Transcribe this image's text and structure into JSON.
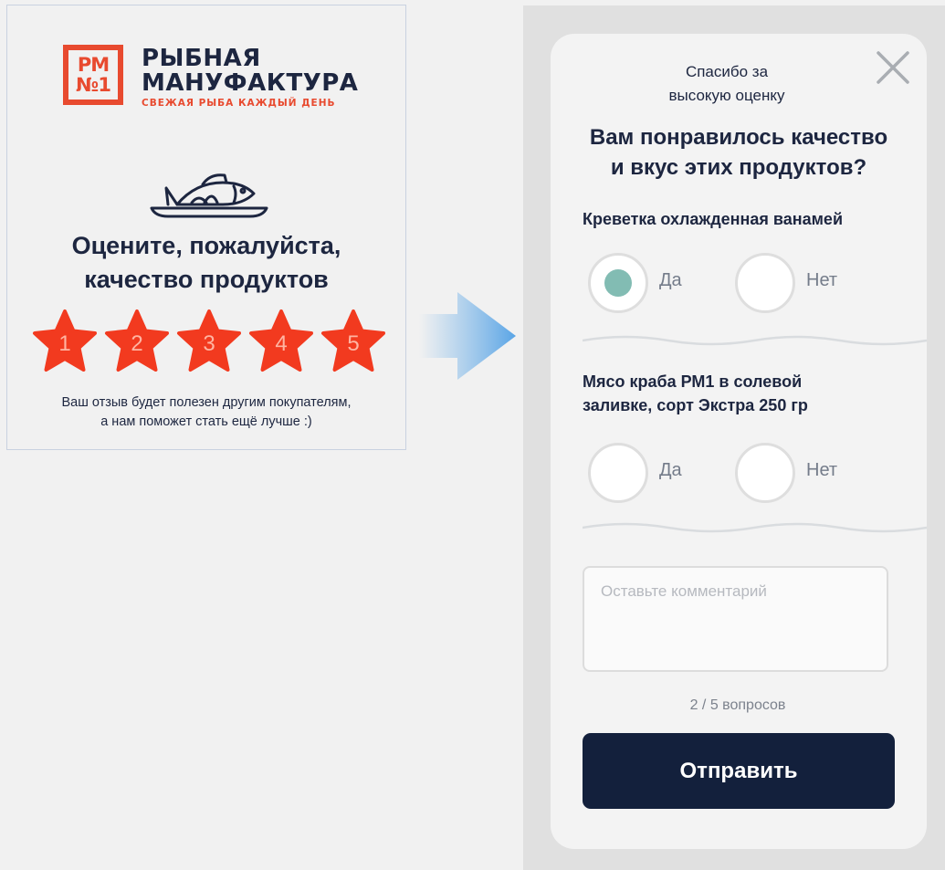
{
  "rating_card": {
    "logo": {
      "badge_line1": "РМ",
      "badge_line2": "№1",
      "name_line1": "РЫБНАЯ",
      "name_line2": "МАНУФАКТУРА",
      "tagline": "СВЕЖАЯ РЫБА КАЖДЫЙ ДЕНЬ"
    },
    "icon": "fish-on-plate-icon",
    "title_line1": "Оцените, пожалуйста,",
    "title_line2": "качество продуктов",
    "stars": [
      "1",
      "2",
      "3",
      "4",
      "5"
    ],
    "note_line1": "Ваш отзыв будет полезен другим покупателям,",
    "note_line2": "а нам поможет стать ещё лучше :)"
  },
  "survey": {
    "thanks_line1": "Спасибо за",
    "thanks_line2": "высокую оценку",
    "question_line1": "Вам понравилось качество",
    "question_line2": "и вкус этих продуктов?",
    "products": [
      {
        "name_line1": "Креветка охлажденная ванамей",
        "name_line2": "",
        "yes_label": "Да",
        "no_label": "Нет",
        "selected": "yes"
      },
      {
        "name_line1": "Мясо краба РМ1 в солевой",
        "name_line2": "заливке, сорт Экстра 250 гр",
        "yes_label": "Да",
        "no_label": "Нет",
        "selected": null
      }
    ],
    "comment_placeholder": "Оставьте комментарий",
    "progress": "2 / 5 вопросов",
    "submit_label": "Отправить"
  },
  "colors": {
    "brand_navy": "#1d2640",
    "brand_red": "#e84a2f",
    "star_red": "#f23a1f",
    "selected_dot": "#82bcb3",
    "button_bg": "#13203c"
  }
}
